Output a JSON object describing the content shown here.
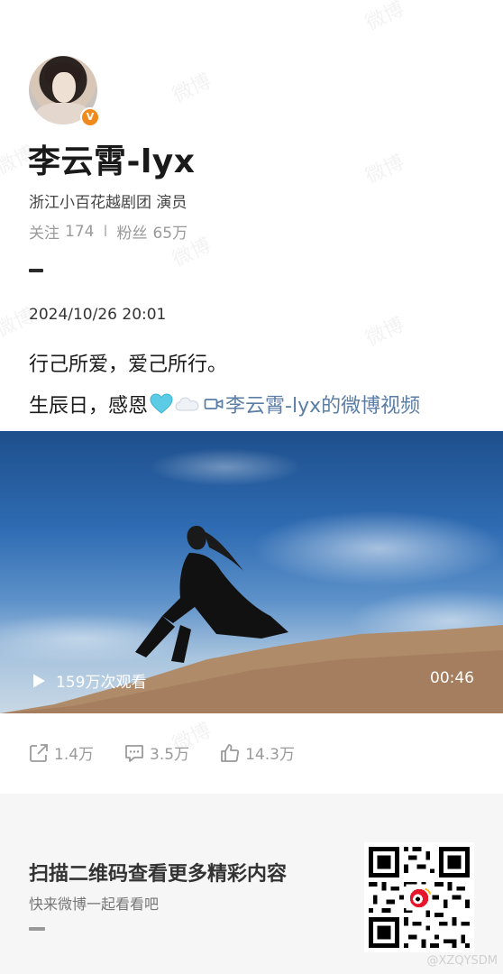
{
  "profile": {
    "name": "李云霄-lyx",
    "verified_badge": "V",
    "bio": "浙江小百花越剧团 演员",
    "following_label": "关注",
    "following_count": "174",
    "followers_label": "粉丝",
    "followers_count": "65万",
    "separator": "I"
  },
  "post": {
    "date": "2024/10/26 20:01",
    "line1": "行己所爱，爱己所行。",
    "line2_text": "生辰日，感恩",
    "emoji_icons": [
      "blue-heart-icon",
      "cloud-icon"
    ],
    "video_link_label": "李云霄-lyx的微博视频",
    "link_color": "#5b7da6"
  },
  "video": {
    "views": "159万次观看",
    "duration": "00:46"
  },
  "actions": {
    "share_count": "1.4万",
    "comment_count": "3.5万",
    "like_count": "14.3万"
  },
  "footer": {
    "title": "扫描二维码查看更多精彩内容",
    "subtitle": "快来微博一起看看吧",
    "handle": "@XZQYSDM"
  },
  "watermark": "微博"
}
